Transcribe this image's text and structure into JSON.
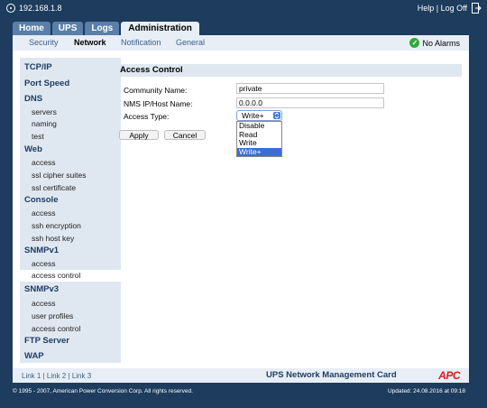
{
  "topbar": {
    "ip": "192.168.1.8",
    "help": "Help",
    "separator": "|",
    "logoff": "Log Off",
    "icons": {
      "ip": "globe-icon",
      "exit": "exit-icon"
    }
  },
  "tabs": [
    "Home",
    "UPS",
    "Logs",
    "Administration"
  ],
  "subtabs": [
    "Security",
    "Network",
    "Notification",
    "General"
  ],
  "alarm": "No Alarms",
  "sidebar": {
    "tcpip": "TCP/IP",
    "port_speed": "Port Speed",
    "dns": "DNS",
    "dns_items": [
      "servers",
      "naming",
      "test"
    ],
    "web": "Web",
    "web_items": [
      "access",
      "ssl cipher suites",
      "ssl certificate"
    ],
    "console": "Console",
    "console_items": [
      "access",
      "ssh encryption",
      "ssh host key"
    ],
    "snmpv1": "SNMPv1",
    "snmpv1_items": [
      "access",
      "access control"
    ],
    "snmpv3": "SNMPv3",
    "snmpv3_items": [
      "access",
      "user profiles",
      "access control"
    ],
    "ftp": "FTP Server",
    "wap": "WAP"
  },
  "panel": {
    "title": "Access Control",
    "community_label": "Community Name:",
    "community_value": "private",
    "nms_label": "NMS IP/Host Name:",
    "nms_value": "0.0.0.0",
    "access_label": "Access Type:",
    "access_value": "Write+",
    "options": [
      "Disable",
      "Read",
      "Write",
      "Write+"
    ],
    "apply": "Apply",
    "cancel": "Cancel"
  },
  "footer": {
    "link1": "Link 1",
    "link2": "Link 2",
    "link3": "Link 3",
    "sep": "|",
    "title": "UPS Network Management Card",
    "brand": "APC",
    "copyright": "© 1995 - 2007, American Power Conversion Corp. All rights reserved.",
    "updated": "Updated: 24.08.2016 at 09:18"
  },
  "colors": {
    "background": "#1d3c5e",
    "accent": "#e01b1b",
    "highlight": "#3d6cd6",
    "ok": "#2fa83a"
  }
}
